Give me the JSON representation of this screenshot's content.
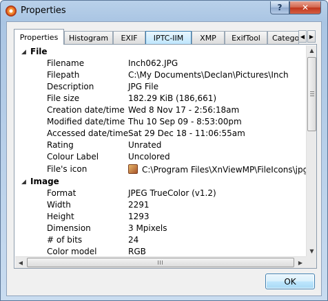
{
  "window": {
    "title": "Properties"
  },
  "titlebar_buttons": {
    "help": "?",
    "close": "✕"
  },
  "tabs": [
    "Properties",
    "Histogram",
    "EXIF",
    "IPTC-IIM",
    "XMP",
    "ExifTool",
    "Categories"
  ],
  "active_tab": "Properties",
  "tab_scroll": {
    "left": "◀",
    "right": "▶"
  },
  "sections": [
    {
      "title": "File",
      "toggle": "◢",
      "rows": [
        {
          "key": "Filename",
          "value": "Inch062.JPG"
        },
        {
          "key": "Filepath",
          "value": "C:\\My Documents\\Declan\\Pictures\\Inch"
        },
        {
          "key": "Description",
          "value": "JPG File"
        },
        {
          "key": "File size",
          "value": "182.29 KiB (186,661)"
        },
        {
          "key": "Creation date/time",
          "value": "Wed 8 Nov 17 - 2:56:18am"
        },
        {
          "key": "Modified date/time",
          "value": "Thu 10 Sep 09 - 8:53:00pm"
        },
        {
          "key": "Accessed date/time",
          "value": "Sat 29 Dec 18 - 11:06:55am"
        },
        {
          "key": "Rating",
          "value": "Unrated"
        },
        {
          "key": "Colour Label",
          "value": "Uncolored"
        },
        {
          "key": "File's icon",
          "value": "C:\\Program Files\\XnViewMP\\FileIcons\\jpg.ico",
          "icon": "file-type-icon"
        }
      ]
    },
    {
      "title": "Image",
      "toggle": "◢",
      "rows": [
        {
          "key": "Format",
          "value": "JPEG TrueColor (v1.2)"
        },
        {
          "key": "Width",
          "value": "2291"
        },
        {
          "key": "Height",
          "value": "1293"
        },
        {
          "key": "Dimension",
          "value": "3 Mpixels"
        },
        {
          "key": "# of bits",
          "value": "24"
        },
        {
          "key": "Color model",
          "value": "RGB"
        }
      ]
    }
  ],
  "scrollbar": {
    "up": "▲",
    "down": "▼",
    "left": "◀",
    "right": "▶"
  },
  "buttons": {
    "ok": "OK"
  }
}
